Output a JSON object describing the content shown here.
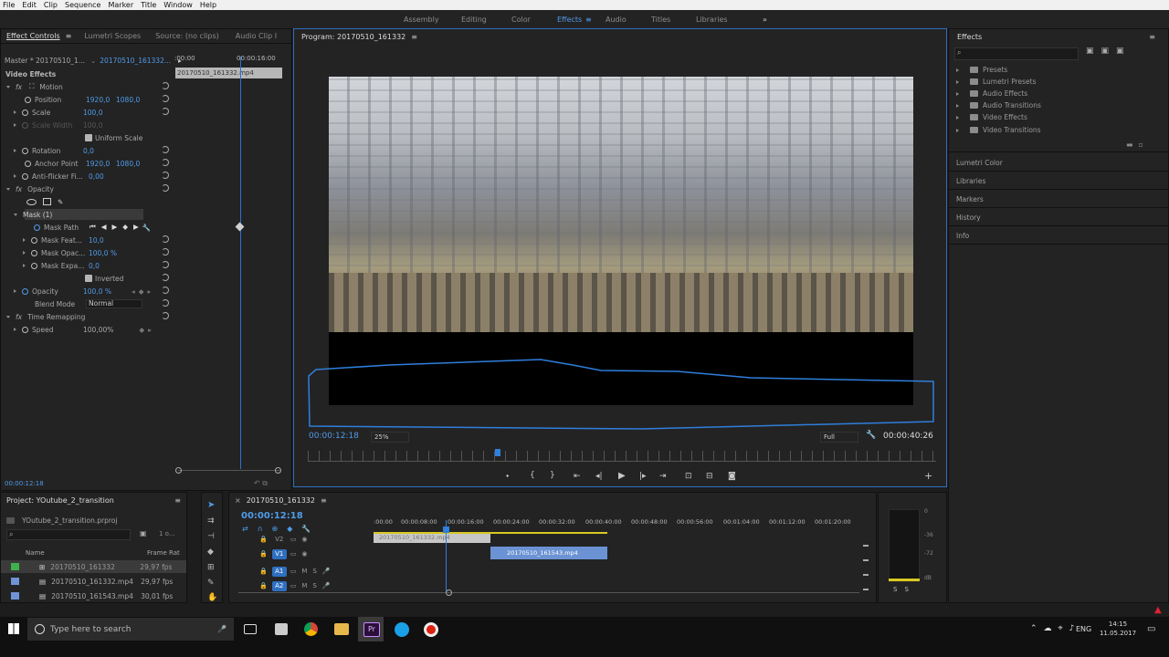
{
  "menu": [
    "File",
    "Edit",
    "Clip",
    "Sequence",
    "Marker",
    "Title",
    "Window",
    "Help"
  ],
  "workspaces": [
    "Assembly",
    "Editing",
    "Color",
    "Effects",
    "Audio",
    "Titles",
    "Libraries"
  ],
  "workspace_active": "Effects",
  "ec": {
    "tabs": [
      "Effect Controls",
      "Lumetri Scopes",
      "Source: (no clips)",
      "Audio Clip I"
    ],
    "master": "Master * 20170510_1...",
    "seq": "20170510_161332...",
    "ruler_start": ":00:00",
    "ruler_end": "00:00:16:00",
    "clip_label": "20170510_161332.mp4",
    "video_effects": "Video Effects",
    "motion": "Motion",
    "position": "Position",
    "position_x": "1920,0",
    "position_y": "1080,0",
    "scale": "Scale",
    "scale_v": "100,0",
    "scale_width": "Scale Width",
    "scale_width_v": "100,0",
    "uniform": "Uniform Scale",
    "rotation": "Rotation",
    "rotation_v": "0,0",
    "anchor": "Anchor Point",
    "anchor_x": "1920,0",
    "anchor_y": "1080,0",
    "antiflicker": "Anti-flicker Fi...",
    "antiflicker_v": "0,00",
    "opacity_fx": "Opacity",
    "mask": "Mask (1)",
    "mask_path": "Mask Path",
    "mask_feather": "Mask Feat...",
    "mask_feather_v": "10,0",
    "mask_opacity": "Mask Opac...",
    "mask_opacity_v": "100,0 %",
    "mask_expansion": "Mask Expa...",
    "mask_expansion_v": "0,0",
    "inverted": "Inverted",
    "opacity": "Opacity",
    "opacity_v": "100,0 %",
    "blend": "Blend Mode",
    "blend_v": "Normal",
    "time_remap": "Time Remapping",
    "speed": "Speed",
    "speed_v": "100,00%",
    "timecode": "00:00:12:18"
  },
  "program": {
    "title": "Program: 20170510_161332",
    "tc_left": "00:00:12:18",
    "zoom": "25%",
    "quality": "Full",
    "tc_right": "00:00:40:26"
  },
  "effects": {
    "title": "Effects",
    "folders": [
      "Presets",
      "Lumetri Presets",
      "Audio Effects",
      "Audio Transitions",
      "Video Effects",
      "Video Transitions"
    ],
    "panels": [
      "Lumetri Color",
      "Libraries",
      "Markers",
      "History",
      "Info"
    ]
  },
  "project": {
    "title": "Project: YOutube_2_transition",
    "file": "YOutube_2_transition.prproj",
    "count": "1 o...",
    "col_name": "Name",
    "col_rate": "Frame Rat",
    "items": [
      {
        "name": "20170510_161332",
        "rate": "29,97 fps",
        "color": "#3fb04a"
      },
      {
        "name": "20170510_161332.mp4",
        "rate": "29,97 fps",
        "color": "#6f93d6"
      },
      {
        "name": "20170510_161543.mp4",
        "rate": "30,01 fps",
        "color": "#6f93d6"
      }
    ]
  },
  "timeline": {
    "title": "20170510_161332",
    "timecode": "00:00:12:18",
    "ruler": [
      ":00:00",
      "00:00:08:00",
      "00:00:16:00",
      "00:00:24:00",
      "00:00:32:00",
      "00:00:40:00",
      "00:00:48:00",
      "00:00:56:00",
      "00:01:04:00",
      "00:01:12:00",
      "00:01:20:00"
    ],
    "tracks": [
      "V2",
      "V1",
      "A1",
      "A2"
    ],
    "clip_v1": "20170510_161543.mp4",
    "clip_v2": "20170510_161332.mp4"
  },
  "meter": [
    "0",
    "-36",
    "-72",
    "dB"
  ],
  "taskbar": {
    "search": "Type here to search",
    "lang": "ENG",
    "time": "14:15",
    "date": "11.05.2017"
  }
}
